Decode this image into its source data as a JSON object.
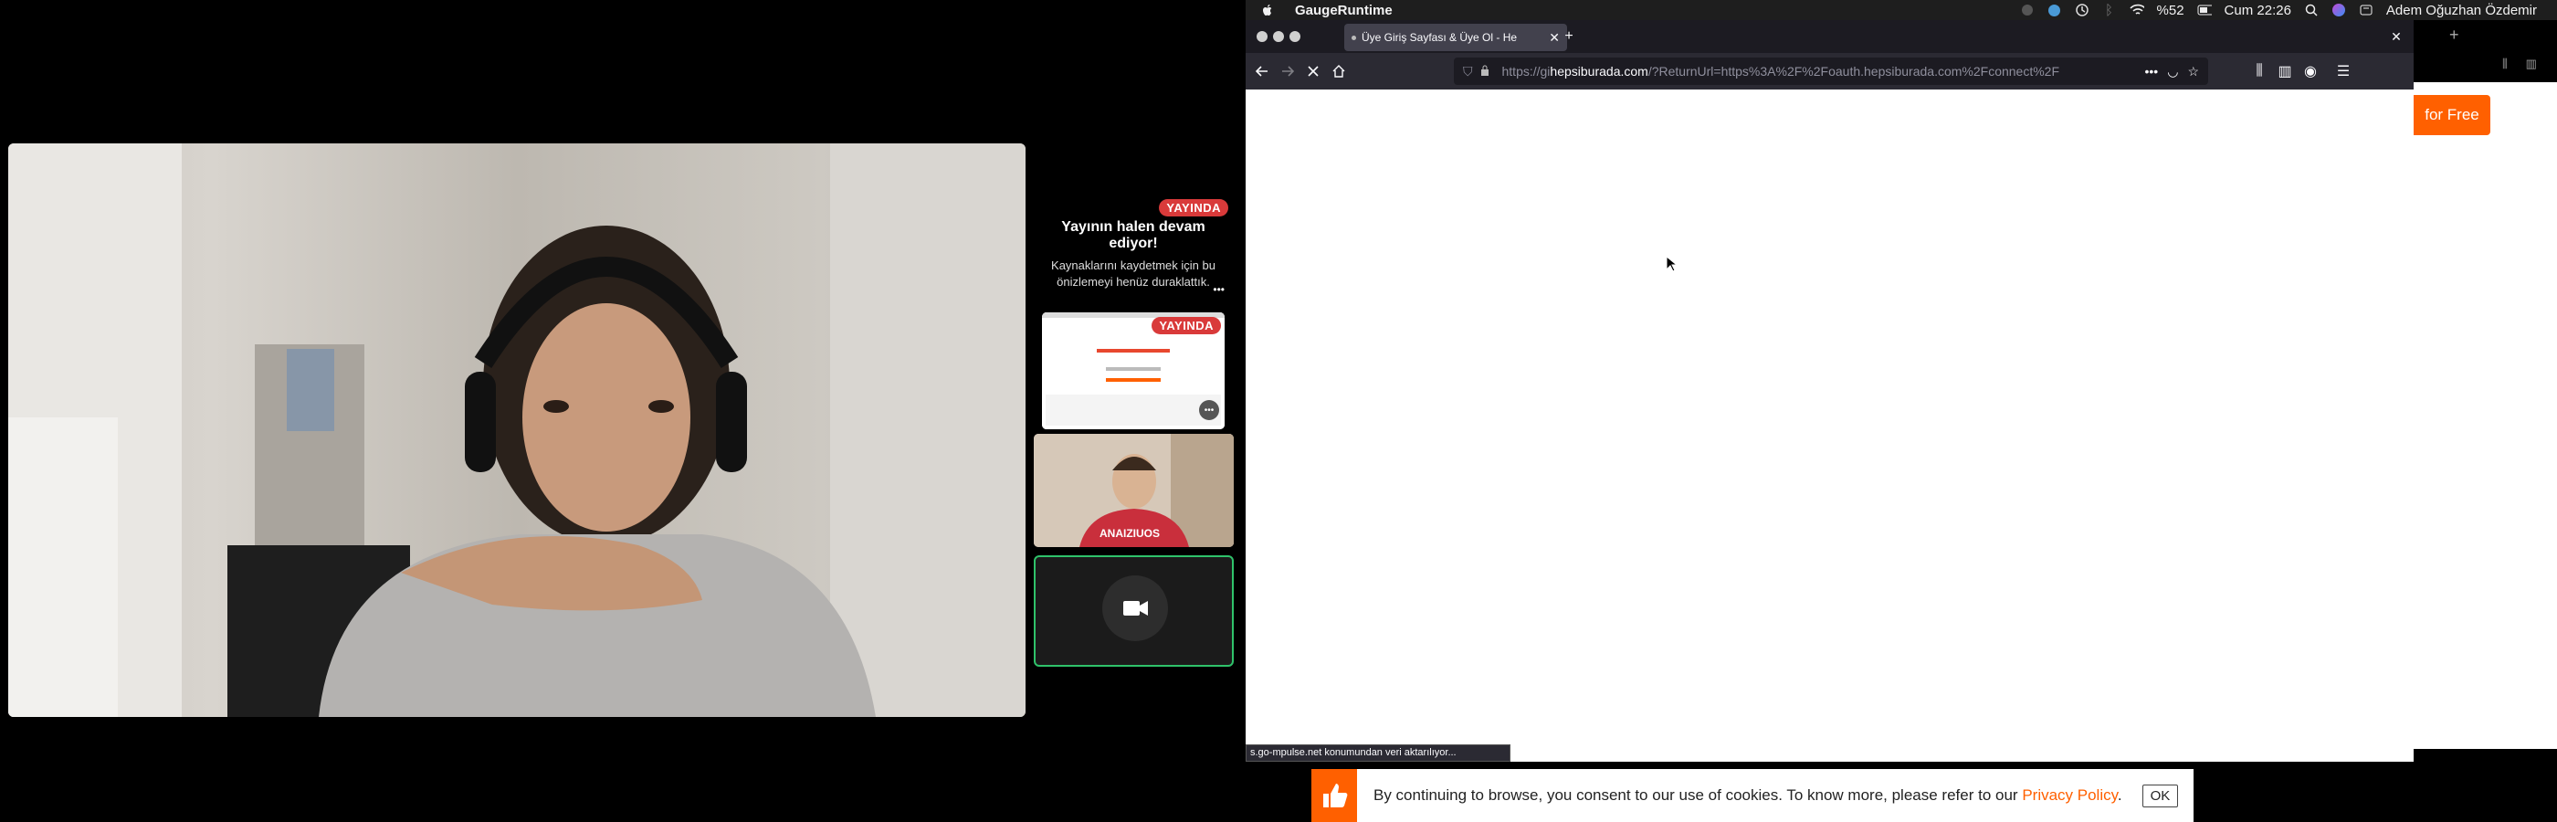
{
  "menubar": {
    "app_name": "GaugeRuntime",
    "battery": "%52",
    "clock": "Cum 22:26",
    "user": "Adem Oğuzhan Özdemir"
  },
  "call": {
    "live_label": "YAYINDA",
    "notice_title": "Yayının halen devam ediyor!",
    "notice_text": "Kaynaklarını kaydetmek için bu önizlemeyi henüz duraklattık.",
    "more_label": "•••",
    "screen_live_label": "YAYINDA",
    "participant_shirt_text": "ANAIZIUOS"
  },
  "browser": {
    "tab_title": "Üye Giriş Sayfası & Üye Ol - He",
    "url_scheme": "https://gi",
    "url_host": "hepsiburada.com",
    "url_path": "/?ReturnUrl=https%3A%2F%2Foauth.hepsiburada.com%2Fconnect%2F",
    "status_text": "s.go-mpulse.net konumundan veri aktarılıyor..."
  },
  "page": {
    "signup_button": "for Free",
    "cookie_text": "By continuing to browse, you consent to our use of cookies. To know more, please refer to our",
    "cookie_link": "Privacy Policy",
    "cookie_period": ".",
    "cookie_ok": "OK"
  },
  "colors": {
    "brand_orange": "#ff6000",
    "live_red": "#d93a3a",
    "active_speaker_green": "#2fc26a"
  }
}
